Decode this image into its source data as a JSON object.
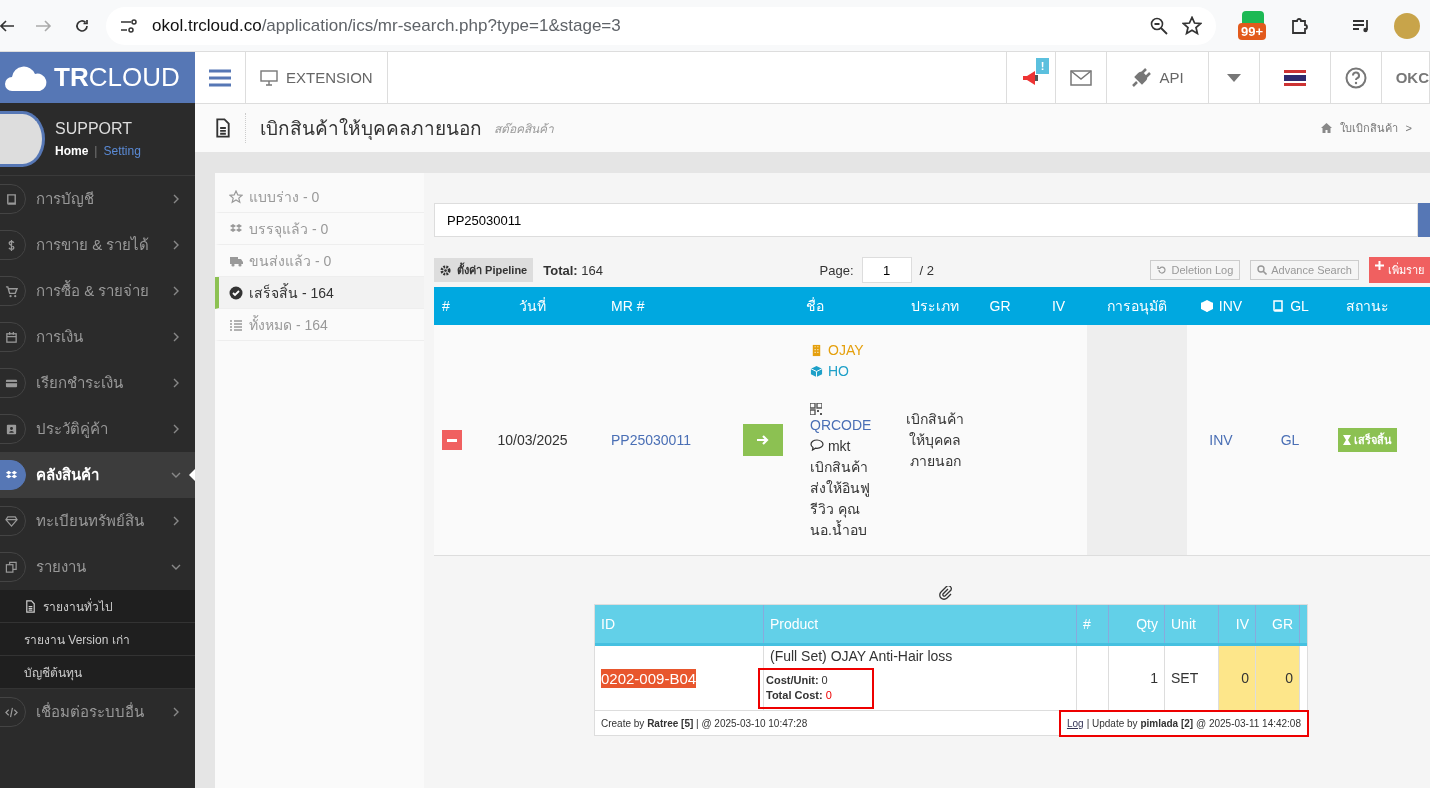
{
  "browser": {
    "url_host": "okol.trcloud.co",
    "url_path": "/application/ics/mr-search.php?type=1&stage=3",
    "extension_badge": "99+"
  },
  "header": {
    "logo": "**TR**CLOUD",
    "extension": "EXTENSION",
    "notice_badge": "!",
    "api": "API",
    "user": "OKC"
  },
  "user": {
    "name": "SUPPORT",
    "home": "Home",
    "separator": "|",
    "setting": "Setting"
  },
  "sidebar": {
    "items": [
      {
        "label": "การบัญชี",
        "selected": false,
        "expanded": false
      },
      {
        "label": "การขาย & รายได้",
        "selected": false,
        "expanded": false
      },
      {
        "label": "การซื้อ & รายจ่าย",
        "selected": false,
        "expanded": false
      },
      {
        "label": "การเงิน",
        "selected": false,
        "expanded": false
      },
      {
        "label": "เรียกชำระเงิน",
        "selected": false,
        "expanded": false
      },
      {
        "label": "ประวัติคู่ค้า",
        "selected": false,
        "expanded": false
      },
      {
        "label": "คลังสินค้า",
        "selected": true,
        "expanded": true
      },
      {
        "label": "ทะเบียนทรัพย์สิน",
        "selected": false,
        "expanded": false
      },
      {
        "label": "รายงาน",
        "selected": false,
        "expanded": true,
        "children": [
          {
            "label": "รายงานทั่วไป"
          },
          {
            "label": "รายงาน Version เก่า"
          },
          {
            "label": "บัญชีต้นทุน"
          }
        ]
      },
      {
        "label": "เชื่อมต่อระบบอื่น",
        "selected": false,
        "expanded": false
      }
    ]
  },
  "page": {
    "title": "เบิกสินค้าให้บุคคลภายนอก",
    "subtitle": "สต๊อคสินค้า",
    "breadcrumb": "ใบเบิกสินค้า",
    "breadcrumb_sep": ">"
  },
  "filters": [
    {
      "label": "แบบร่าง - 0",
      "selected": false
    },
    {
      "label": "บรรจุแล้ว - 0",
      "selected": false
    },
    {
      "label": "ขนส่งแล้ว - 0",
      "selected": false
    },
    {
      "label": "เสร็จสิ้น - 164",
      "selected": true
    },
    {
      "label": "ทั้งหมด - 164",
      "selected": false
    }
  ],
  "search": {
    "value": "PP25030011"
  },
  "toolbar": {
    "pipeline": "ตั้งค่า Pipeline",
    "total_label": "Total:",
    "total": "164",
    "page_label": "Page:",
    "page": "1",
    "pages": "/ 2",
    "deletion_log": "Deletion Log",
    "advance_search": "Advance Search",
    "add": "เพิ่มราย"
  },
  "table": {
    "columns": [
      "#",
      "วันที่",
      "MR #",
      "ชื่อ",
      "ประเภท",
      "GR",
      "IV",
      "การอนุมัติ",
      "INV",
      "GL",
      "สถานะ"
    ],
    "rows": [
      {
        "expanded": true,
        "date": "10/03/2025",
        "mr": "PP25030011",
        "company": "OJAY",
        "branch": "HO",
        "qr": "QRCODE",
        "note": "mkt เบิกสินค้าส่งให้อินฟูรีวิว คุณนอ.น้ำอบ",
        "type": "เบิกสินค้าให้บุคคลภายนอก",
        "inv": "INV",
        "gl": "GL",
        "status": "เสร็จสิ้น",
        "detail": {
          "columns": [
            "ID",
            "Product",
            "#",
            "Qty",
            "Unit",
            "IV",
            "GR"
          ],
          "items": [
            {
              "id": "0202-009-B04",
              "product": "(Full Set) OJAY Anti-Hair loss",
              "cost_unit_label": "Cost/Unit:",
              "cost_unit": "0",
              "total_cost_label": "Total Cost:",
              "total_cost": "0",
              "qty": "1",
              "unit": "SET",
              "iv": "0",
              "gr": "0"
            }
          ],
          "created": "Create by **Ratree [5]** | @ 2025-03-10 10:47:28",
          "log": "Log",
          "updated": "| Update by **pimlada [2]** @ 2025-03-11 14:42:08"
        }
      }
    ]
  }
}
